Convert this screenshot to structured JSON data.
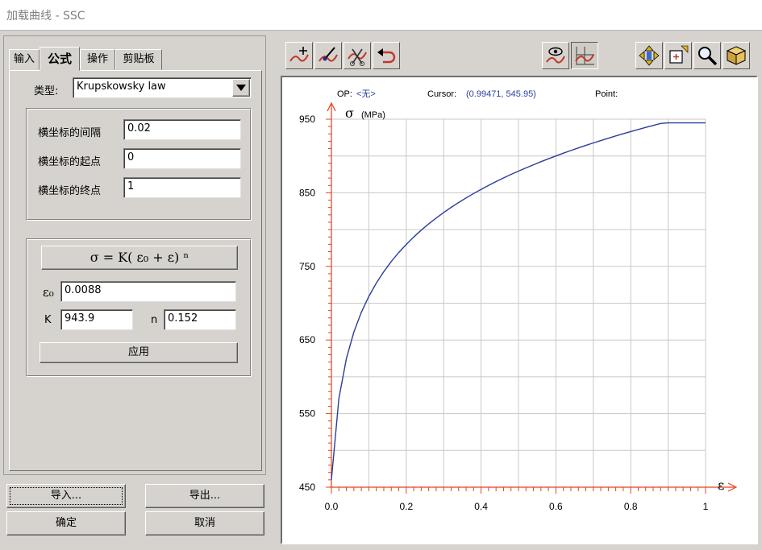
{
  "window": {
    "title": "加载曲线 - SSC"
  },
  "tabs": [
    {
      "label": "输入",
      "active": false
    },
    {
      "label": "公式",
      "active": true
    },
    {
      "label": "操作",
      "active": false
    },
    {
      "label": "剪贴板",
      "active": false
    }
  ],
  "type_row": {
    "label": "类型:",
    "value": "Krupskowsky law"
  },
  "range": {
    "interval_label": "横坐标的间隔",
    "interval_value": "0.02",
    "start_label": "横坐标的起点",
    "start_value": "0",
    "end_label": "横坐标的终点",
    "end_value": "1"
  },
  "formula": {
    "text": "σ = K( ε₀ + ε) ⁿ",
    "eps0_label": "ε₀",
    "eps0_value": "0.0088",
    "k_label": "K",
    "k_value": "943.9",
    "n_label": "n",
    "n_value": "0.152",
    "apply_label": "应用"
  },
  "buttons": {
    "import": "导入...",
    "export": "导出...",
    "ok": "确定",
    "cancel": "取消"
  },
  "toolbar": {
    "left": [
      "add-point-icon",
      "edit-point-icon",
      "delete-point-icon",
      "undo-icon"
    ],
    "middle": [
      "view-curve-icon",
      "grid-curve-icon"
    ],
    "right": [
      "pan-icon",
      "zoom-box-icon",
      "zoom-icon",
      "3d-box-icon"
    ]
  },
  "status": {
    "op_label": "OP:",
    "op_value": "<无>",
    "cursor_label": "Cursor:",
    "cursor_value": "(0.99471, 545.95)",
    "point_label": "Point:"
  },
  "colors": {
    "curve": "#2a3f99",
    "axis": "#e8401c",
    "grid": "#c8c8c8",
    "status_value": "#2a3f99"
  },
  "chart_data": {
    "type": "line",
    "ylabel": "σ",
    "yunit": "(MPa)",
    "xlabel": "ε",
    "xlim": [
      0,
      1
    ],
    "ylim": [
      450,
      950
    ],
    "xticks": [
      "0.0",
      "0.2",
      "0.4",
      "0.6",
      "0.8",
      "1"
    ],
    "yticks": [
      "450",
      "550",
      "650",
      "750",
      "850",
      "950"
    ],
    "grid": true,
    "series": [
      {
        "x": [
          0,
          0.02,
          0.04,
          0.06,
          0.08,
          0.1,
          0.12,
          0.14,
          0.16,
          0.18,
          0.2,
          0.22,
          0.24,
          0.26,
          0.28,
          0.3,
          0.32,
          0.34,
          0.36,
          0.38,
          0.4,
          0.42,
          0.44,
          0.46,
          0.48,
          0.5,
          0.52,
          0.54,
          0.56,
          0.58,
          0.6,
          0.62,
          0.64,
          0.66,
          0.68,
          0.7,
          0.72,
          0.74,
          0.76,
          0.78,
          0.8,
          0.82,
          0.84,
          0.86,
          0.88,
          0.9,
          0.92,
          0.94,
          0.96,
          0.98,
          1
        ],
        "y": [
          460.1,
          570.9,
          624.8,
          660.6,
          687.6,
          709.2,
          727.3,
          742.9,
          756.6,
          768.8,
          779.8,
          789.9,
          799.2,
          807.7,
          815.7,
          823.2,
          830.2,
          836.8,
          843.0,
          849.0,
          854.6,
          860.0,
          865.2,
          870.1,
          874.9,
          879.4,
          883.8,
          888.1,
          892.2,
          896.2,
          900.0,
          903.8,
          907.4,
          910.9,
          914.3,
          917.7,
          920.9,
          924.1,
          927.2,
          930.2,
          933.1,
          936.0,
          938.8,
          941.5,
          944.2,
          946.9,
          949.4,
          952.0,
          954.4,
          956.9,
          945.0
        ]
      }
    ]
  }
}
